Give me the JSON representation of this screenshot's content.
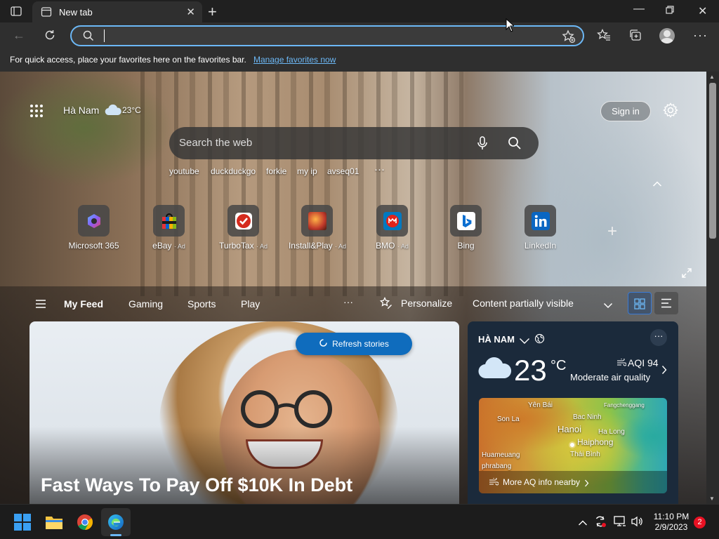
{
  "browser": {
    "tab_title": "New tab",
    "address_value": ""
  },
  "favorites_bar": {
    "hint": "For quick access, place your favorites here on the favorites bar.",
    "manage_link": "Manage favorites now"
  },
  "newtab": {
    "location": "Hà Nam",
    "temp_small": "23°C",
    "sign_in": "Sign in",
    "search_placeholder": "Search the web",
    "quick_searches": [
      "youtube",
      "duckduckgo",
      "forkie",
      "my ip",
      "avseq01"
    ],
    "quick_links": [
      {
        "label": "Microsoft 365",
        "ad": ""
      },
      {
        "label": "eBay",
        "ad": "· Ad"
      },
      {
        "label": "TurboTax",
        "ad": "· Ad"
      },
      {
        "label": "Install&Play",
        "ad": "· Ad"
      },
      {
        "label": "BMO",
        "ad": "· Ad"
      },
      {
        "label": "Bing",
        "ad": ""
      },
      {
        "label": "LinkedIn",
        "ad": ""
      }
    ],
    "feed_tabs": [
      "My Feed",
      "Gaming",
      "Sports",
      "Play"
    ],
    "personalize": "Personalize",
    "content_visibility": "Content partially visible",
    "refresh": "Refresh stories",
    "headline": "Fast Ways To Pay Off $10K In Debt"
  },
  "weather": {
    "location": "HÀ NAM",
    "temp": "23",
    "unit": "°C",
    "aqi": "AQI 94",
    "aqi_desc": "Moderate air quality",
    "more_link": "More AQ info nearby",
    "map_labels": [
      "Yên Bái",
      "Bac Ninh",
      "Fangchenggang",
      "Son La",
      "Hanoi",
      "Ha Long",
      "Haiphong",
      "Thái Bình",
      "Huameuang",
      "phrabang"
    ]
  },
  "taskbar": {
    "time": "11:10 PM",
    "date": "2/9/2023",
    "notifications": "2"
  },
  "colors": {
    "accent": "#0f6cbd",
    "address_focus": "#6cb8f6",
    "badge": "#e81123"
  }
}
